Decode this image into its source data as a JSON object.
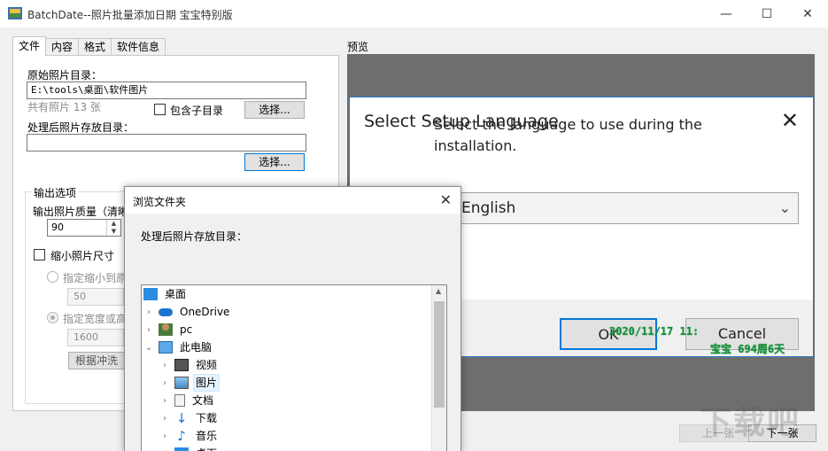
{
  "window": {
    "title": "BatchDate--照片批量添加日期 宝宝特别版",
    "minimize": "—",
    "maximize": "☐",
    "close": "✕"
  },
  "tabs": [
    {
      "label": "文件"
    },
    {
      "label": "内容"
    },
    {
      "label": "格式"
    },
    {
      "label": "软件信息"
    }
  ],
  "file_tab": {
    "source_label": "原始照片目录：",
    "source_value": "E:\\tools\\桌面\\软件图片",
    "photo_count": "共有照片 13 张",
    "include_subdirs": "包含子目录",
    "browse_btn": "选择...",
    "output_label": "处理后照片存放目录：",
    "output_value": "",
    "browse_btn2": "选择..."
  },
  "output_options": {
    "group_label": "输出选项",
    "quality_label": "输出照片质量（清晰",
    "quality_value": "90",
    "shrink_label": "缩小照片尺寸",
    "radio1_label": "指定缩小到原",
    "percent_value": "50",
    "radio2_label": "指定宽度或高",
    "size_value": "1600",
    "print_btn": "根据冲洗"
  },
  "preview": {
    "label": "预览",
    "setup_title": "Select Setup Language",
    "setup_msg": "Select the language to use during the installation.",
    "language": "English",
    "ok": "OK",
    "cancel": "Cancel",
    "stamp_line1": "2020/11/17 11:",
    "stamp_line2": "宝宝 694周6天"
  },
  "browse_dialog": {
    "title": "浏览文件夹",
    "prompt": "处理后照片存放目录：",
    "tree": [
      {
        "label": "桌面",
        "icon": "desktop-icon"
      },
      {
        "label": "OneDrive",
        "icon": "cloud-icon"
      },
      {
        "label": "pc",
        "icon": "user-icon"
      },
      {
        "label": "此电脑",
        "icon": "computer-icon"
      },
      {
        "label": "视频",
        "icon": "video-icon"
      },
      {
        "label": "图片",
        "icon": "pictures-icon"
      },
      {
        "label": "文档",
        "icon": "documents-icon"
      },
      {
        "label": "下载",
        "icon": "download-icon"
      },
      {
        "label": "音乐",
        "icon": "music-icon"
      },
      {
        "label": "桌面",
        "icon": "desktop-icon"
      }
    ]
  },
  "nav": {
    "prev": "上一张",
    "next": "下一张"
  },
  "watermark": "下载吧"
}
